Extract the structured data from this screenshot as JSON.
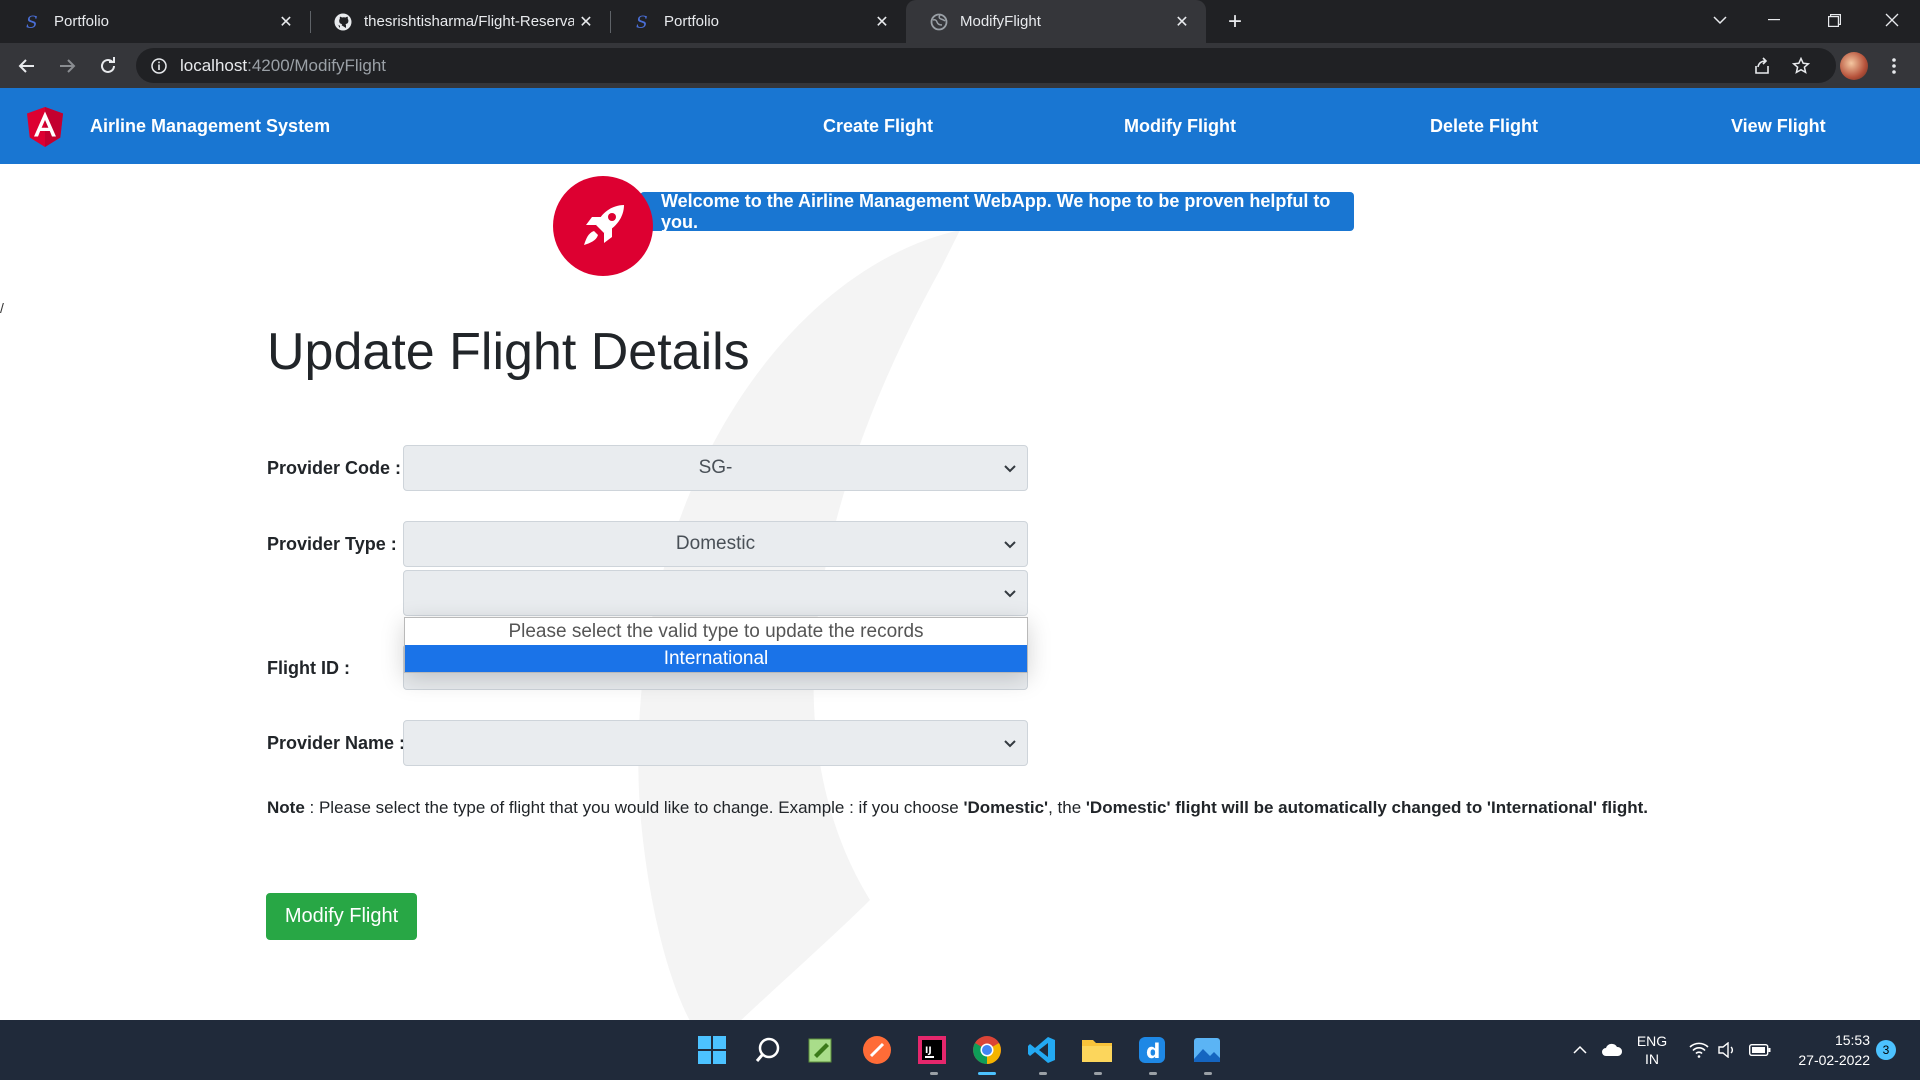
{
  "browser": {
    "tabs": [
      {
        "title": "Portfolio",
        "active": false
      },
      {
        "title": "thesrishtisharma/Flight-Reservati",
        "active": false
      },
      {
        "title": "Portfolio",
        "active": false
      },
      {
        "title": "ModifyFlight",
        "active": true
      }
    ],
    "url_host": "localhost",
    "url_path": ":4200/ModifyFlight"
  },
  "nav": {
    "brand": "Airline Management System",
    "links": [
      "Create Flight",
      "Modify Flight",
      "Delete Flight",
      "View Flight"
    ]
  },
  "welcome": "Welcome to the Airline Management WebApp. We hope to be proven helpful to you.",
  "stray_text": "/",
  "page_title": "Update Flight Details",
  "form": {
    "provider_code_label": "Provider Code :",
    "provider_code_value": "SG-",
    "provider_type_label": "Provider Type :",
    "provider_type_value": "Domestic",
    "new_type_value": "",
    "flight_id_label": "Flight ID :",
    "provider_name_label": "Provider Name :",
    "provider_name_value": "",
    "dropdown_options": [
      "Please select the valid type to update the records",
      "International"
    ],
    "dropdown_selected_index": 1
  },
  "note": {
    "label": "Note",
    "text1": " : Please select the type of flight that you would like to change. Example : if you choose ",
    "bold1": "'Domestic'",
    "text2": ", the ",
    "bold2": "'Domestic' flight will be automatically changed to 'International' flight."
  },
  "modify_button": "Modify Flight",
  "taskbar": {
    "lang_top": "ENG",
    "lang_bottom": "IN",
    "time": "15:53",
    "date": "27-02-2022",
    "notifications": "3"
  },
  "colors": {
    "nav_blue": "#1976d2",
    "angular_red": "#dd0031",
    "button_green": "#28a745",
    "selected_option": "#1a73e8"
  }
}
